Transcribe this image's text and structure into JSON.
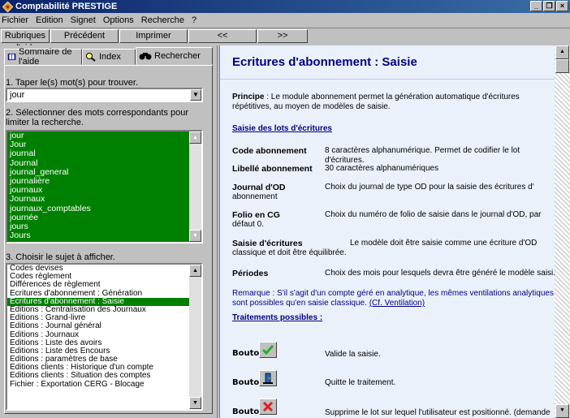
{
  "window": {
    "title": "Comptabilité PRESTIGE",
    "btn_min": "_",
    "btn_max": "❐",
    "btn_close": "×"
  },
  "menu": [
    "Fichier",
    "Edition",
    "Signet",
    "Options",
    "Recherche",
    "?"
  ],
  "toolbar": [
    "Rubriques d'aide",
    "Précédent",
    "Imprimer",
    "<<",
    ">>"
  ],
  "tabs": {
    "sommaire": "Sommaire de l'aide",
    "index": "Index",
    "rechercher": "Rechercher"
  },
  "search": {
    "step1": "1. Taper le(s) mot(s) pour trouver.",
    "value": "jour",
    "step2": "2. Sélectionner des mots correspondants pour limiter la recherche.",
    "step3": "3. Choisir le sujet à afficher."
  },
  "words": [
    "jour",
    "Jour",
    "journal",
    "Journal",
    "journal_general",
    "journalière",
    "journaux",
    "Journaux",
    "journaux_comptables",
    "journée",
    "jours",
    "Jours"
  ],
  "topics": [
    "Codes devises",
    "Codes règlement",
    "Différences de règlement",
    "Ecritures d'abonnement : Génération",
    "Ecritures d'abonnement : Saisie",
    "Editions : Centralisation des Journaux",
    "Editions : Grand-livre",
    "Editions : Journal général",
    "Editions : Journaux",
    "Editions : Liste des avoirs",
    "Editions : Liste des Encours",
    "Editions : paramètres de base",
    "Editions clients : Historique d'un compte",
    "Editions clients : Situation des comptes",
    "Fichier : Exportation CERG - Blocage"
  ],
  "selected_topic_index": 4,
  "doc": {
    "title": "Ecritures d'abonnement : Saisie",
    "principe_label": "Principe",
    "principe_text": " : Le module abonnement permet la génération automatique d'écritures répétitives, au moyen de modèles de saisie.",
    "section1": "Saisie des lots d'écritures",
    "fields": [
      {
        "label": "Code abonnement",
        "desc": "8 caractères alphanumérique. Permet de codifier le lot d'écritures."
      },
      {
        "label": "Libellé abonnement",
        "desc": "30 caractères alphanumériques"
      },
      {
        "label": "Journal d'OD",
        "desc": "Choix du journal de type OD pour la saisie des écritures d'",
        "extra": "abonnement"
      },
      {
        "label": "Folio en CG",
        "desc": "Choix du numéro de folio de saisie dans le journal d'OD, par",
        "extra": "défaut 0."
      },
      {
        "label": "Saisie d'écritures",
        "desc": "Le modèle doit être saisie comme une écriture d'OD",
        "extra": "classique et doit être équilibrée."
      },
      {
        "label": "Périodes",
        "desc": "Choix des mois pour lesquels devra être généré le modèle saisi."
      }
    ],
    "remarque": "Remarque : S'il s'agit d'un compte géré en analytique, les mêmes ventilations analytiques sont possibles qu'en saisie classique.",
    "remarque_link": "(Cf. Ventilation)",
    "section2": "Traitements possibles :",
    "buttons": [
      {
        "label": "Bouton",
        "desc": "Valide la saisie.",
        "icon": "check-icon"
      },
      {
        "label": "Bouton",
        "desc": "Quitte le traitement.",
        "icon": "exit-door-icon"
      },
      {
        "label": "Bouton",
        "desc": "Supprime le lot sur lequel l'utilisateur est positionné. (demande",
        "icon": "delete-x-icon"
      }
    ]
  },
  "colors": {
    "selection": "#008000",
    "title": "#000080",
    "panel_bg": "#ebf1fb"
  }
}
